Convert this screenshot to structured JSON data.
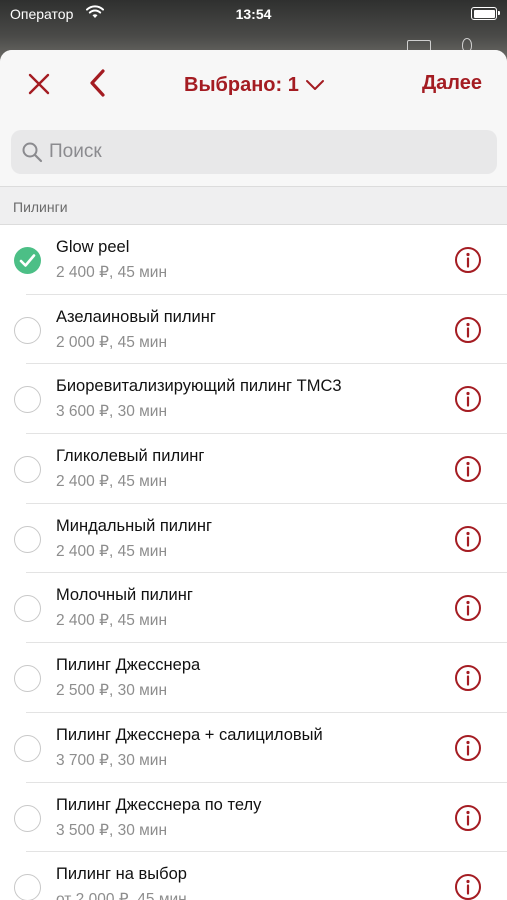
{
  "statusbar": {
    "carrier": "Оператор",
    "time": "13:54"
  },
  "header": {
    "selected_label": "Выбрано: 1",
    "next_label": "Далее"
  },
  "search": {
    "placeholder": "Поиск"
  },
  "section": {
    "title": "Пилинги"
  },
  "colors": {
    "accent": "#a41c22",
    "check": "#4cbf86"
  },
  "services": [
    {
      "name": "Glow peel",
      "price": "2 400 ₽",
      "duration": "45 мин",
      "selected": true
    },
    {
      "name": "Азелаиновый пилинг",
      "price": "2 000 ₽",
      "duration": "45 мин",
      "selected": false
    },
    {
      "name": "Биоревитализирующий пилинг TMC3",
      "price": "3 600 ₽",
      "duration": "30 мин",
      "selected": false
    },
    {
      "name": "Гликолевый пилинг",
      "price": "2 400 ₽",
      "duration": "45 мин",
      "selected": false
    },
    {
      "name": "Миндальный пилинг",
      "price": "2 400 ₽",
      "duration": "45 мин",
      "selected": false
    },
    {
      "name": "Молочный пилинг",
      "price": "2 400 ₽",
      "duration": "45 мин",
      "selected": false
    },
    {
      "name": "Пилинг Джесснера",
      "price": "2 500 ₽",
      "duration": "30 мин",
      "selected": false
    },
    {
      "name": "Пилинг Джесснера + салициловый",
      "price": "3 700 ₽",
      "duration": "30 мин",
      "selected": false
    },
    {
      "name": "Пилинг Джесснера по телу",
      "price": "3 500 ₽",
      "duration": "30 мин",
      "selected": false
    },
    {
      "name": "Пилинг на выбор",
      "price": "от 2 000 ₽",
      "duration": "45 мин",
      "selected": false
    }
  ]
}
